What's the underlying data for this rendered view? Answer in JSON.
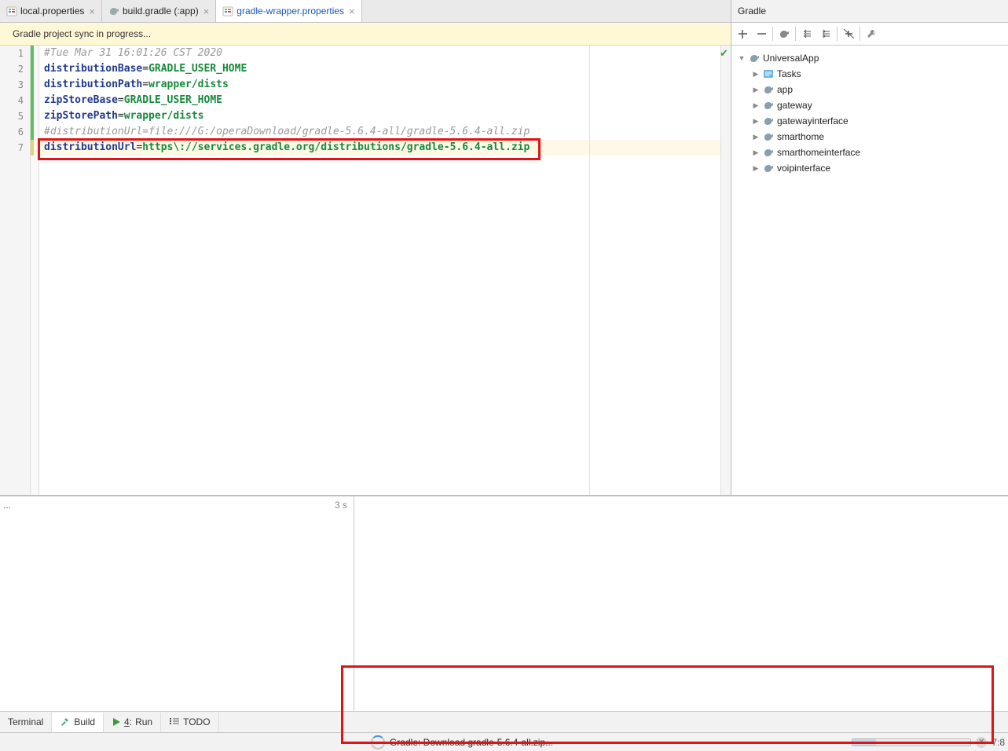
{
  "tabs": [
    {
      "label": "local.properties",
      "icon": "prop-colored",
      "active": false,
      "closable": true
    },
    {
      "label": "build.gradle (:app)",
      "icon": "elephant",
      "active": false,
      "closable": true
    },
    {
      "label": "gradle-wrapper.properties",
      "icon": "prop-colored",
      "active": true,
      "closable": true
    }
  ],
  "sync_message": "Gradle project sync in progress...",
  "code_lines": [
    {
      "n": 1,
      "strip": "green",
      "segments": [
        {
          "t": "#Tue Mar 31 16:01:26 CST 2020",
          "c": "comment"
        }
      ]
    },
    {
      "n": 2,
      "strip": "green",
      "segments": [
        {
          "t": "distributionBase",
          "c": "key"
        },
        {
          "t": "="
        },
        {
          "t": "GRADLE_USER_HOME",
          "c": "val"
        }
      ]
    },
    {
      "n": 3,
      "strip": "green",
      "segments": [
        {
          "t": "distributionPath",
          "c": "key"
        },
        {
          "t": "="
        },
        {
          "t": "wrapper/dists",
          "c": "val"
        }
      ]
    },
    {
      "n": 4,
      "strip": "green",
      "segments": [
        {
          "t": "zipStoreBase",
          "c": "key"
        },
        {
          "t": "="
        },
        {
          "t": "GRADLE_USER_HOME",
          "c": "val"
        }
      ]
    },
    {
      "n": 5,
      "strip": "green",
      "segments": [
        {
          "t": "zipStorePath",
          "c": "key"
        },
        {
          "t": "="
        },
        {
          "t": "wrapper/dists",
          "c": "val"
        }
      ]
    },
    {
      "n": 6,
      "strip": "green",
      "segments": [
        {
          "t": "#distributionUrl=file:///G:/operaDownload/gradle-5.6.4-all/gradle-5.6.4-all.zip",
          "c": "comment"
        }
      ]
    },
    {
      "n": 7,
      "strip": "yellow",
      "active": true,
      "segments": [
        {
          "t": "distributionUrl",
          "c": "key"
        },
        {
          "t": "="
        },
        {
          "t": "https\\://services.gradle.org/distributions/gradle-5.6.4-all.zip",
          "c": "val"
        }
      ]
    }
  ],
  "gradle_panel": {
    "title": "Gradle",
    "tree": [
      {
        "label": "UniversalApp",
        "icon": "elephant-dark",
        "indent": 0,
        "expanded": true
      },
      {
        "label": "Tasks",
        "icon": "tasks",
        "indent": 1,
        "expanded": false
      },
      {
        "label": "app",
        "icon": "elephant-dark",
        "indent": 1,
        "expanded": false
      },
      {
        "label": "gateway",
        "icon": "elephant-dark",
        "indent": 1,
        "expanded": false
      },
      {
        "label": "gatewayinterface",
        "icon": "elephant-dark",
        "indent": 1,
        "expanded": false
      },
      {
        "label": "smarthome",
        "icon": "elephant-dark",
        "indent": 1,
        "expanded": false
      },
      {
        "label": "smarthomeinterface",
        "icon": "elephant-dark",
        "indent": 1,
        "expanded": false
      },
      {
        "label": "voipinterface",
        "icon": "elephant-dark",
        "indent": 1,
        "expanded": false
      }
    ]
  },
  "lower": {
    "dots": "...",
    "time": "3 s"
  },
  "bottom_tabs": [
    {
      "label": "Terminal",
      "icon": "",
      "active": false,
      "prefix": ""
    },
    {
      "label": "Build",
      "icon": "hammer",
      "active": true,
      "prefix": ""
    },
    {
      "label": "Run",
      "icon": "play",
      "active": false,
      "prefix": "4:"
    },
    {
      "label": "TODO",
      "icon": "list",
      "active": false,
      "prefix": ""
    }
  ],
  "status": {
    "text": "Gradle: Download gradle-5.6.4-all.zip...",
    "loc": "7:8"
  }
}
